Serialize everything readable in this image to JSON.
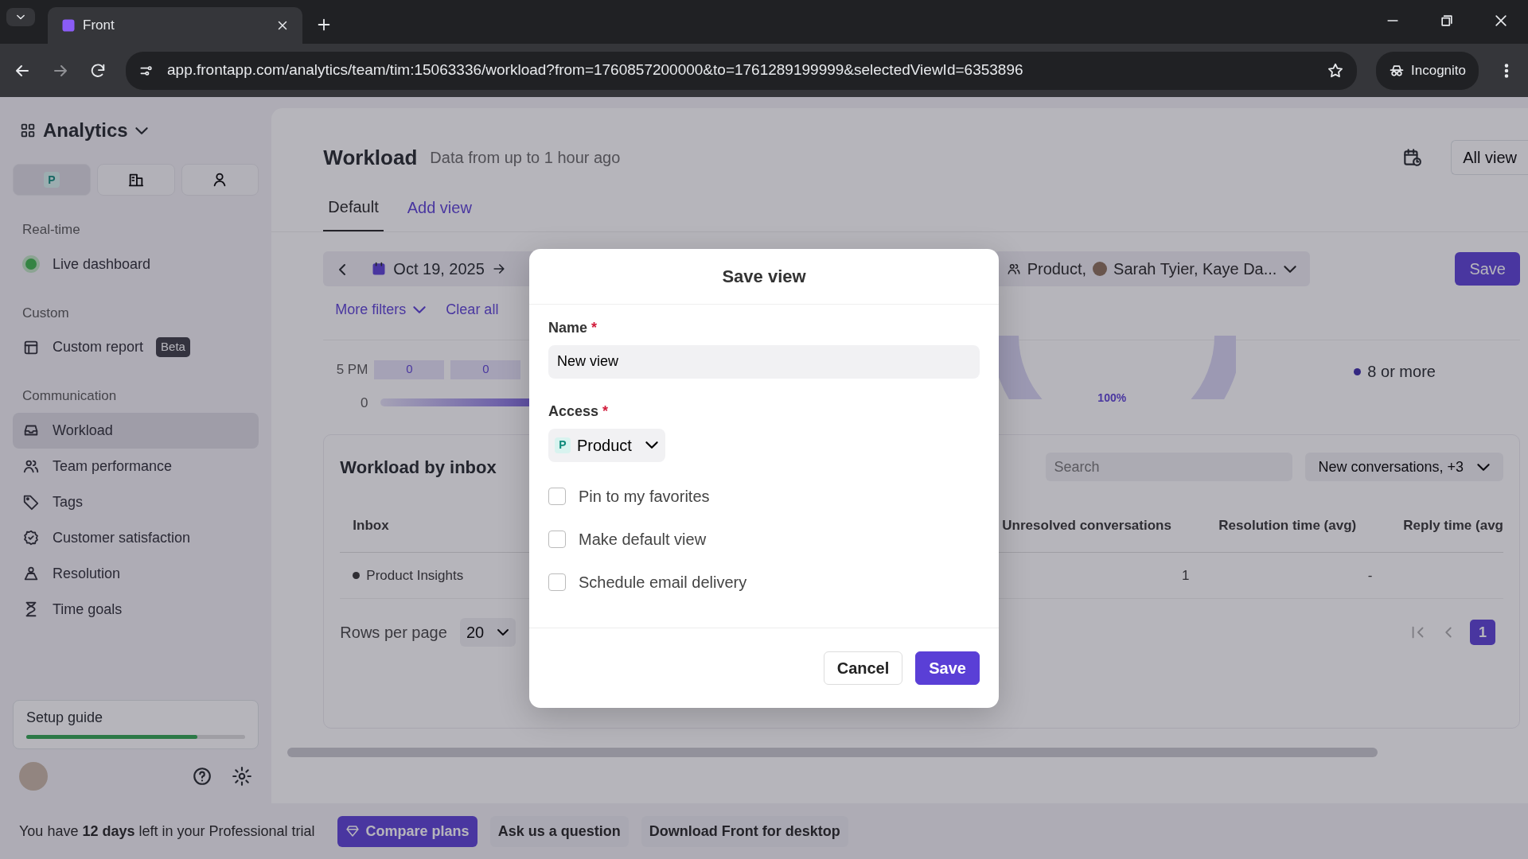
{
  "browser": {
    "tab_title": "Front",
    "url": "app.frontapp.com/analytics/team/tim:15063336/workload?from=1760857200000&to=1761289199999&selectedViewId=6353896",
    "profile": "Incognito"
  },
  "sidebar": {
    "title": "Analytics",
    "scopes": [
      {
        "kind": "letter",
        "text": "P",
        "selected": true
      },
      {
        "kind": "building",
        "selected": false
      },
      {
        "kind": "person",
        "selected": false
      }
    ],
    "sections": [
      {
        "heading": "Real-time",
        "items": [
          {
            "label": "Live dashboard",
            "selected": false
          }
        ]
      },
      {
        "heading": "Custom",
        "items": [
          {
            "label": "Custom report",
            "badge": "Beta",
            "selected": false
          }
        ]
      },
      {
        "heading": "Communication",
        "items": [
          {
            "label": "Workload",
            "selected": true
          },
          {
            "label": "Team performance",
            "selected": false
          },
          {
            "label": "Tags",
            "selected": false
          },
          {
            "label": "Customer satisfaction",
            "selected": false
          },
          {
            "label": "Resolution",
            "selected": false
          },
          {
            "label": "Time goals",
            "selected": false
          }
        ]
      }
    ],
    "setup_guide": {
      "label": "Setup guide",
      "level": 0.78
    }
  },
  "main": {
    "title": "Workload",
    "subtitle": "Data from up to 1 hour ago",
    "all_views": "All view",
    "tabs": [
      {
        "label": "Default",
        "selected": true
      },
      {
        "label": "Add view",
        "selected": false
      }
    ],
    "date": "Oct 19, 2025",
    "filter": "Product,",
    "filter_people": "Sarah Tyier, Kaye Da...",
    "save": "Save",
    "more_filters": "More filters",
    "clear": "Clear all",
    "heatmap_rows": [
      {
        "label": "5 PM",
        "cells": [
          "0",
          "0"
        ]
      }
    ],
    "axis_label": "0",
    "donut_label": "100%",
    "legend": [
      "8 or more"
    ],
    "inbox": {
      "title": "Workload by inbox",
      "search_placeholder": "Search",
      "metrics": "New conversations, +3",
      "columns": [
        "Inbox",
        "Unresolved conversations",
        "Resolution time (avg)",
        "Reply time (avg"
      ],
      "rows": [
        {
          "cells": [
            "Product Insights",
            "1",
            "-"
          ]
        }
      ],
      "rows_per_page_label": "Rows per page",
      "rows_per_page": "20",
      "page": "1"
    }
  },
  "trial_bar": {
    "message": "You have **12 days** left in your Professional trial",
    "buttons": [
      {
        "label": "Compare plans",
        "kind": "primary"
      },
      {
        "label": "Ask us a question",
        "kind": "plain"
      },
      {
        "label": "Download Front for desktop",
        "kind": "plain"
      }
    ]
  },
  "modal": {
    "title": "Save view",
    "name": {
      "label": "Name",
      "mark": "*",
      "value": "New view"
    },
    "access": {
      "label": "Access",
      "mark": "*",
      "badge": "P",
      "value": "Product"
    },
    "options": [
      {
        "label": "Pin to my favorites",
        "checked": false
      },
      {
        "label": "Make default view",
        "checked": false
      },
      {
        "label": "Schedule email delivery",
        "checked": false
      }
    ],
    "buttons": [
      {
        "label": "Cancel",
        "kind": "secondary"
      },
      {
        "label": "Save",
        "kind": "primary"
      }
    ]
  }
}
